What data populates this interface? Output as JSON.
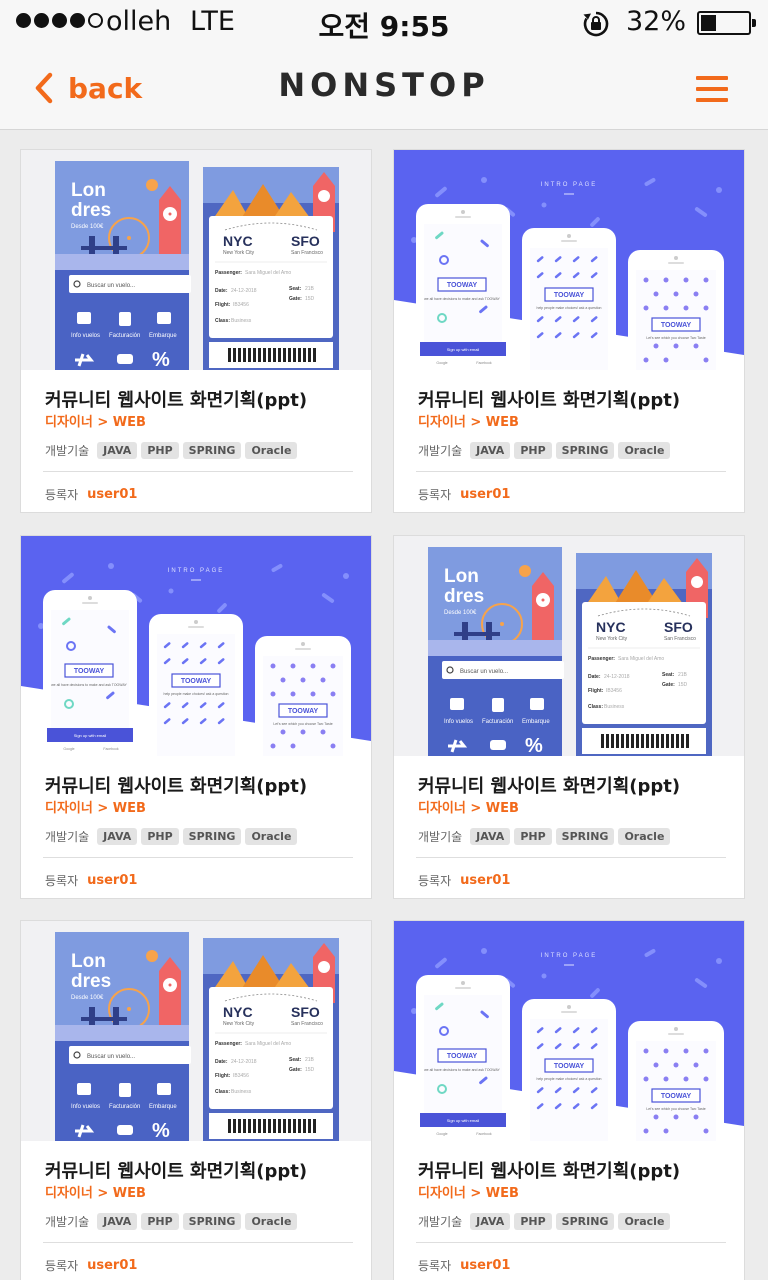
{
  "status_bar": {
    "carrier": "olleh",
    "network": "LTE",
    "time": "오전 9:55",
    "battery": "32%",
    "signal_bars": 4,
    "battery_level": 0.32
  },
  "nav": {
    "back_label": "back",
    "title": "NONSTOP",
    "accent": "#f26a1b"
  },
  "labels": {
    "tech_label": "개발기술",
    "author_label": "등록자"
  },
  "cards": [
    {
      "design": "londres",
      "title": "커뮤니티 웹사이트 화면기획(ppt)",
      "category": "디자이너 > WEB",
      "tags": [
        "JAVA",
        "PHP",
        "SPRING",
        "Oracle"
      ],
      "author": "user01"
    },
    {
      "design": "intro",
      "title": "커뮤니티 웹사이트 화면기획(ppt)",
      "category": "디자이너 > WEB",
      "tags": [
        "JAVA",
        "PHP",
        "SPRING",
        "Oracle"
      ],
      "author": "user01"
    },
    {
      "design": "intro",
      "title": "커뮤니티 웹사이트 화면기획(ppt)",
      "category": "디자이너 > WEB",
      "tags": [
        "JAVA",
        "PHP",
        "SPRING",
        "Oracle"
      ],
      "author": "user01"
    },
    {
      "design": "londres",
      "title": "커뮤니티 웹사이트 화면기획(ppt)",
      "category": "디자이너 > WEB",
      "tags": [
        "JAVA",
        "PHP",
        "SPRING",
        "Oracle"
      ],
      "author": "user01"
    },
    {
      "design": "londres",
      "title": "커뮤니티 웹사이트 화면기획(ppt)",
      "category": "디자이너 > WEB",
      "tags": [
        "JAVA",
        "PHP",
        "SPRING",
        "Oracle"
      ],
      "author": "user01"
    },
    {
      "design": "intro",
      "title": "커뮤니티 웹사이트 화면기획(ppt)",
      "category": "디자이너 > WEB",
      "tags": [
        "JAVA",
        "PHP",
        "SPRING",
        "Oracle"
      ],
      "author": "user01"
    }
  ],
  "thumbnails": {
    "londres": {
      "city_lines": [
        "Lon",
        "dres"
      ],
      "price": "Desde 100€",
      "search_placeholder": "Buscar un vuelo...",
      "menu_items": [
        "Info vuelos",
        "Facturación",
        "Embarque"
      ],
      "from_code": "NYC",
      "from_city": "New York City",
      "to_code": "SFO",
      "to_city": "San Francisco",
      "fields": [
        "Passenger:",
        "Date:",
        "Seat:",
        "Flight:",
        "Gate:",
        "Class:"
      ],
      "field_values": [
        "Sara Miguel del Amo",
        "24-12-2018",
        "21B",
        "IB3456",
        "15D",
        "Business"
      ]
    },
    "intro": {
      "label": "INTRO PAGE",
      "brand": "TOOWAY",
      "tagline_1": "we all have decisions to make and ask TOOWAY",
      "tagline_2": "help people make choices! ask a question",
      "tagline_3": "Let's see which you choose Two Taste",
      "signup": "Sign up with email",
      "social": [
        "Google",
        "Facebook"
      ]
    }
  }
}
